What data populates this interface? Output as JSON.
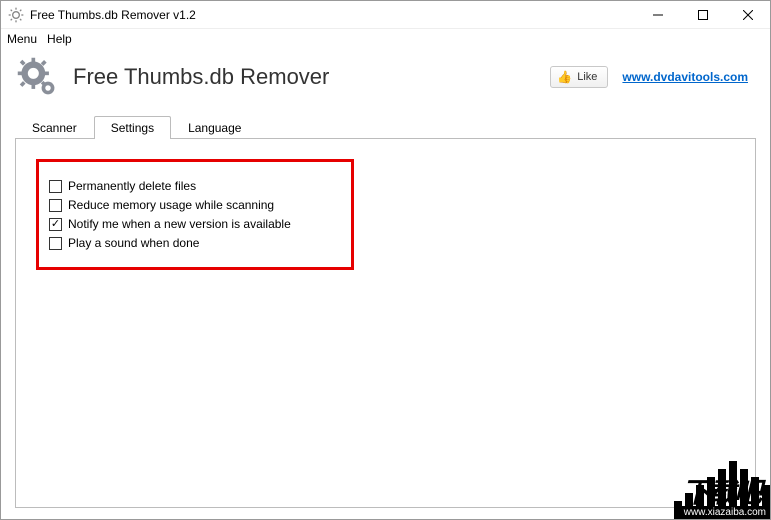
{
  "window": {
    "title": "Free Thumbs.db Remover v1.2"
  },
  "menubar": {
    "menu": "Menu",
    "help": "Help"
  },
  "header": {
    "app_title": "Free Thumbs.db Remover",
    "like_label": "Like",
    "site_link": "www.dvdavitools.com"
  },
  "tabs": {
    "scanner": "Scanner",
    "settings": "Settings",
    "language": "Language",
    "active": "settings"
  },
  "settings": {
    "options": [
      {
        "label": "Permanently delete files",
        "checked": false
      },
      {
        "label": "Reduce memory usage while scanning",
        "checked": false
      },
      {
        "label": "Notify me when a new version is available",
        "checked": true
      },
      {
        "label": "Play a sound when done",
        "checked": false
      }
    ]
  },
  "watermark": {
    "site": "www.xiazaiba.com",
    "big": "下载吧"
  }
}
